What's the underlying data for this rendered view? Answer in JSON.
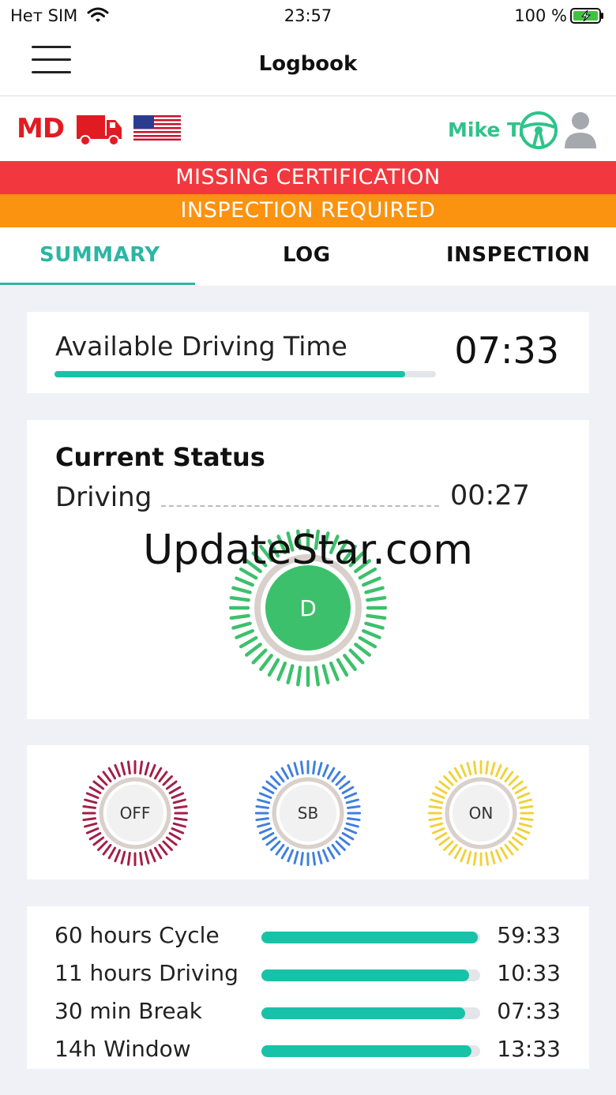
{
  "statusbar": {
    "carrier": "Нет SIM",
    "time": "23:57",
    "battery": "100 %"
  },
  "navbar": {
    "title": "Logbook"
  },
  "info": {
    "state": "MD",
    "driver": "Mike T."
  },
  "alerts": {
    "certification": "MISSING CERTIFICATION",
    "inspection": "INSPECTION REQUIRED"
  },
  "tabs": [
    {
      "label": "SUMMARY",
      "active": true
    },
    {
      "label": "LOG",
      "active": false
    },
    {
      "label": "INSPECTION",
      "active": false
    }
  ],
  "available": {
    "label": "Available Driving Time",
    "time": "07:33",
    "progress": 0.92
  },
  "current": {
    "heading": "Current Status",
    "state": "Driving",
    "time": "00:27",
    "code": "D",
    "color": "#3dc06b"
  },
  "watermark": "UpdateStar.com",
  "modes": [
    {
      "code": "OFF",
      "color": "#a31e48"
    },
    {
      "code": "SB",
      "color": "#3f7fe0"
    },
    {
      "code": "ON",
      "color": "#f0d23c"
    }
  ],
  "clocks": [
    {
      "name": "60 hours Cycle",
      "value": "59:33",
      "progress": 0.99
    },
    {
      "name": "11 hours Driving",
      "value": "10:33",
      "progress": 0.95
    },
    {
      "name": "30 min Break",
      "value": "07:33",
      "progress": 0.93
    },
    {
      "name": "14h Window",
      "value": "13:33",
      "progress": 0.96
    }
  ],
  "colors": {
    "accent": "#2bb6a3",
    "progress": "#18c2a9",
    "alert_red": "#f2383e",
    "alert_orange": "#fb9210",
    "brand_red": "#e11b22",
    "driver_green": "#2ec38a"
  },
  "icons": {
    "menu": "hamburger-icon",
    "truck": "truck-icon",
    "flag": "us-flag-icon",
    "wheel": "steering-wheel-icon",
    "person": "person-icon"
  }
}
